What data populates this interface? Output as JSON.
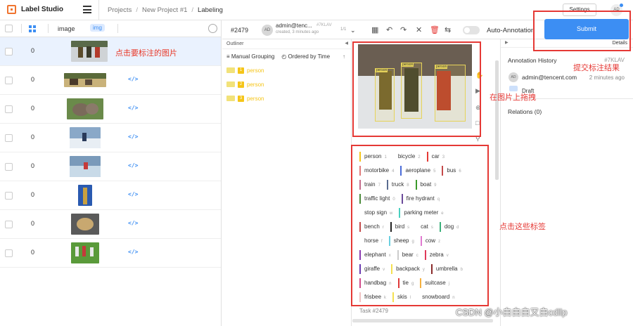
{
  "app": {
    "name": "Label Studio"
  },
  "breadcrumb": [
    "Projects",
    "New Project #1",
    "Labeling"
  ],
  "header": {
    "settings_label": "Settings",
    "user_initials": "AD"
  },
  "task_table": {
    "columns": {
      "image": "image",
      "type_tag": "img"
    },
    "rows": [
      {
        "num": "0",
        "selected": true
      },
      {
        "num": "0",
        "selected": false
      },
      {
        "num": "0",
        "selected": false
      },
      {
        "num": "0",
        "selected": false
      },
      {
        "num": "0",
        "selected": false
      },
      {
        "num": "0",
        "selected": false
      },
      {
        "num": "0",
        "selected": false
      },
      {
        "num": "0",
        "selected": false
      }
    ],
    "code_glyph": "</>"
  },
  "labeling": {
    "task_id": "#2479",
    "annotator": {
      "initials": "AD",
      "user": "admin@tenc...",
      "created": "created, 3 minutes ago",
      "id": "#7KLAV",
      "count": "1/1"
    },
    "auto_annotation": "Auto-Annotation",
    "submit_label": "Submit",
    "details_label": "Details",
    "footer": "Task #2479"
  },
  "outliner": {
    "title": "Outliner",
    "grouping": "Manual Grouping",
    "ordered": "Ordered by Time",
    "regions": [
      {
        "idx": "1",
        "label": "person"
      },
      {
        "idx": "2",
        "label": "person"
      },
      {
        "idx": "3",
        "label": "person"
      }
    ]
  },
  "boxes": [
    {
      "label": "person"
    },
    {
      "label": "person"
    },
    {
      "label": "person"
    }
  ],
  "label_rows": [
    [
      {
        "name": "person",
        "hk": "1",
        "color": "#f5c518"
      },
      {
        "name": "bicycle",
        "hk": "2",
        "color": "#ffffff"
      },
      {
        "name": "car",
        "hk": "3",
        "color": "#e53935"
      }
    ],
    [
      {
        "name": "motorbike",
        "hk": "4",
        "color": "#e07a7a"
      },
      {
        "name": "aeroplane",
        "hk": "5",
        "color": "#4a6bd8"
      },
      {
        "name": "bus",
        "hk": "6",
        "color": "#c44a4a"
      }
    ],
    [
      {
        "name": "train",
        "hk": "7",
        "color": "#c46a8a"
      },
      {
        "name": "truck",
        "hk": "8",
        "color": "#5a6c90"
      },
      {
        "name": "boat",
        "hk": "9",
        "color": "#3a9a2a"
      }
    ],
    [
      {
        "name": "traffic light",
        "hk": "0",
        "color": "#4a8a3a"
      },
      {
        "name": "fire hydrant",
        "hk": "q",
        "color": "#6a4a9a"
      }
    ],
    [
      {
        "name": "stop sign",
        "hk": "w",
        "color": "#ffffff"
      },
      {
        "name": "parking meter",
        "hk": "e",
        "color": "#4ad0c0"
      }
    ],
    [
      {
        "name": "bench",
        "hk": "r",
        "color": "#c44a4a"
      },
      {
        "name": "bird",
        "hk": "s",
        "color": "#222222"
      },
      {
        "name": "cat",
        "hk": "s",
        "color": "#ffffff"
      },
      {
        "name": "dog",
        "hk": "d",
        "color": "#3ab07a"
      }
    ],
    [
      {
        "name": "horse",
        "hk": "f",
        "color": "#ffffff"
      },
      {
        "name": "sheep",
        "hk": "g",
        "color": "#6ad0e0"
      },
      {
        "name": "cow",
        "hk": "z",
        "color": "#e07ad0"
      }
    ],
    [
      {
        "name": "elephant",
        "hk": "x",
        "color": "#8a3ab0"
      },
      {
        "name": "bear",
        "hk": "c",
        "color": "#cccccc"
      },
      {
        "name": "zebra",
        "hk": "v",
        "color": "#e03a5a"
      }
    ],
    [
      {
        "name": "giraffe",
        "hk": "v",
        "color": "#6a3ab0"
      },
      {
        "name": "backpack",
        "hk": "y",
        "color": "#f5e050"
      },
      {
        "name": "umbrella",
        "hk": "b",
        "color": "#8a2a2a"
      }
    ],
    [
      {
        "name": "handbag",
        "hk": "n",
        "color": "#d04a8a"
      },
      {
        "name": "tie",
        "hk": "g",
        "color": "#e03a3a"
      },
      {
        "name": "suitcase",
        "hk": "j",
        "color": "#f5b040"
      }
    ],
    [
      {
        "name": "frisbee",
        "hk": "k",
        "color": "#f0c0c0"
      },
      {
        "name": "skis",
        "hk": "l",
        "color": "#f5e050"
      },
      {
        "name": "snowboard",
        "hk": "n",
        "color": "#ffffff"
      }
    ]
  ],
  "history": {
    "title": "Annotation History",
    "id": "#7KLAV",
    "initials": "AD",
    "user": "admin@tencent.com",
    "time": "2 minutes ago",
    "state": "Draft",
    "relations": "Relations (0)"
  },
  "notes": {
    "click_image": "点击要标注的图片",
    "drag_on_image": "在图片上拖拽",
    "submit_result": "提交标注结果",
    "click_labels": "点击这些标签"
  },
  "watermark": "CSDN @小白白白又白cdllp"
}
